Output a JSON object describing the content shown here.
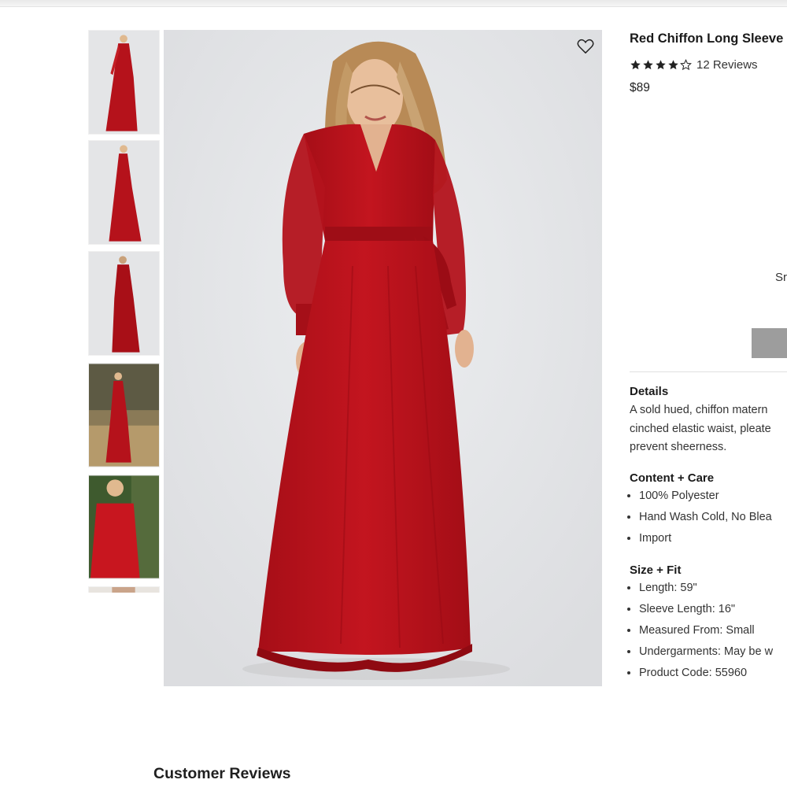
{
  "product": {
    "title": "Red Chiffon Long Sleeve",
    "rating": 4,
    "rating_max": 5,
    "reviews_label": "12 Reviews",
    "price": "$89",
    "size_label_partial": "Sr"
  },
  "details": {
    "heading": "Details",
    "lines": [
      "A sold hued, chiffon matern",
      "cinched elastic waist, pleate",
      "prevent sheerness."
    ]
  },
  "content_care": {
    "heading": "Content + Care",
    "items": [
      "100% Polyester",
      "Hand Wash Cold, No Blea",
      "Import"
    ]
  },
  "size_fit": {
    "heading": "Size + Fit",
    "items": [
      "Length: 59\"",
      "Sleeve Length: 16\"",
      "Measured From: Small",
      "Undergarments: May be w",
      "Product Code: 55960"
    ]
  },
  "reviews_section": {
    "heading": "Customer Reviews"
  },
  "colors": {
    "dress_red": "#b5121b",
    "add_button": "#9d9d9d",
    "photo_bg": "#e4e5e7"
  },
  "icons": {
    "wishlist": "heart-icon",
    "rating": "star-icon"
  }
}
